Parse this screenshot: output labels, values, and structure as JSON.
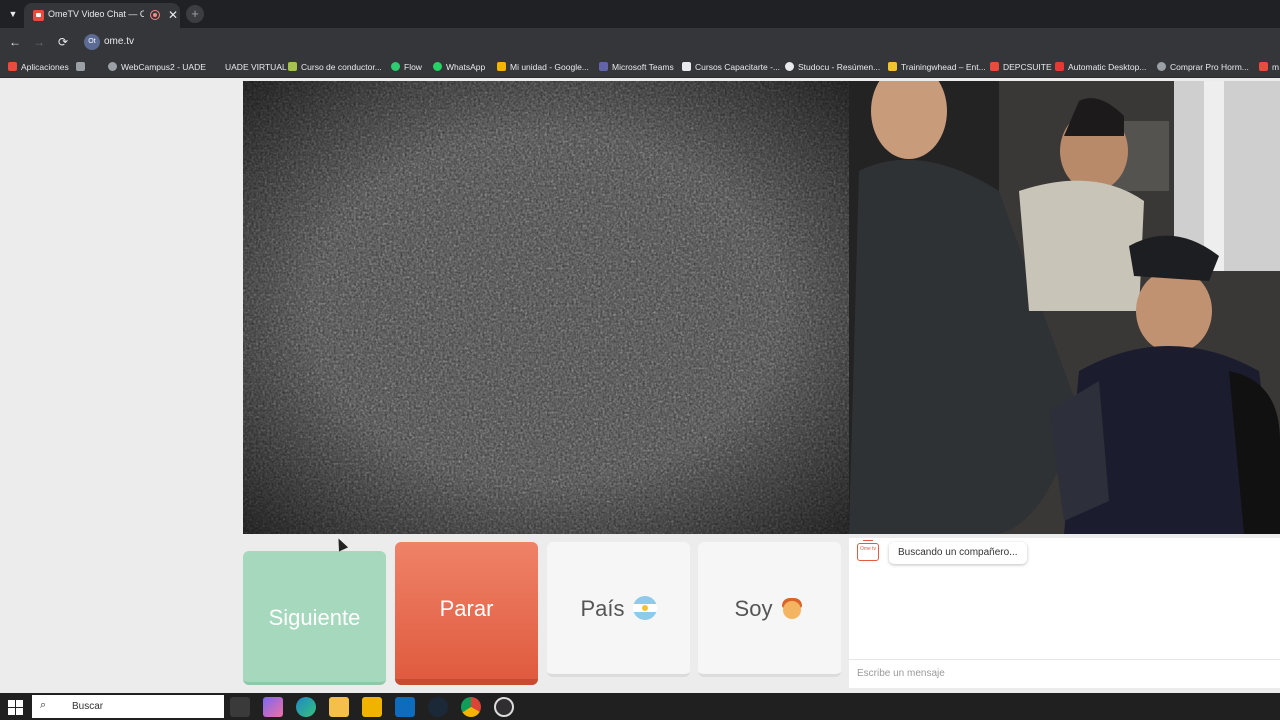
{
  "browser": {
    "tab_title": "OmeTV Video Chat — Ome",
    "tab_close_glyph": "✕",
    "new_tab_glyph": "+",
    "url": "ome.tv",
    "site_icon_text": "Ot",
    "bookmarks": [
      {
        "label": "Aplicaciones",
        "icon": "apps-grid-icon",
        "color": "#e74c3c"
      },
      {
        "label": "",
        "icon": "grid-icon",
        "color": "#9aa0a6"
      },
      {
        "label": "WebCampus2 - UADE",
        "icon": "globe-icon",
        "color": "#9aa0a6"
      },
      {
        "label": "UADE VIRTUAL",
        "icon": "blank-icon",
        "color": "#35363a"
      },
      {
        "label": "Curso de conductor...",
        "icon": "folder-icon",
        "color": "#a6c24a"
      },
      {
        "label": "Flow",
        "icon": "flow-icon",
        "color": "#2ecc71"
      },
      {
        "label": "WhatsApp",
        "icon": "whatsapp-icon",
        "color": "#25d366"
      },
      {
        "label": "Mi unidad - Google...",
        "icon": "drive-icon",
        "color": "#f4b400"
      },
      {
        "label": "Microsoft Teams",
        "icon": "teams-icon",
        "color": "#6264a7"
      },
      {
        "label": "Cursos Capacitarte -...",
        "icon": "capacitarte-icon",
        "color": "#e8eaed"
      },
      {
        "label": "Studocu - Resúmen...",
        "icon": "studocu-icon",
        "color": "#e8eaed"
      },
      {
        "label": "Trainingwhead – Ent...",
        "icon": "trainingwhead-icon",
        "color": "#f2c230"
      },
      {
        "label": "DEPCSUITE",
        "icon": "depcsuite-icon",
        "color": "#e74c3c"
      },
      {
        "label": "Automatic Desktop...",
        "icon": "automatic-icon",
        "color": "#e53935"
      },
      {
        "label": "Comprar Pro Horm...",
        "icon": "person-icon",
        "color": "#9aa0a6"
      },
      {
        "label": "m",
        "icon": "more-icon",
        "color": "#e74c3c"
      }
    ]
  },
  "controls": {
    "next_label": "Siguiente",
    "stop_label": "Parar",
    "country_label": "País",
    "gender_label": "Soy"
  },
  "chat": {
    "logo_text": "Ome tv",
    "status_message": "Buscando un compañero...",
    "input_placeholder": "Escribe un mensaje"
  },
  "taskbar": {
    "search_placeholder": "Buscar",
    "apps": [
      {
        "name": "task-view-icon",
        "color": "#3a3a3a"
      },
      {
        "name": "copilot-icon",
        "color": "#7b68ee"
      },
      {
        "name": "edge-icon",
        "color": "#1e88c8"
      },
      {
        "name": "file-explorer-icon",
        "color": "#f4c04a"
      },
      {
        "name": "store-icon",
        "color": "#f0b400"
      },
      {
        "name": "outlook-icon",
        "color": "#0f6cbd"
      },
      {
        "name": "steam-icon",
        "color": "#1b2838"
      },
      {
        "name": "chrome-icon",
        "color": "#db4437"
      },
      {
        "name": "obs-icon",
        "color": "#302e31"
      }
    ]
  }
}
